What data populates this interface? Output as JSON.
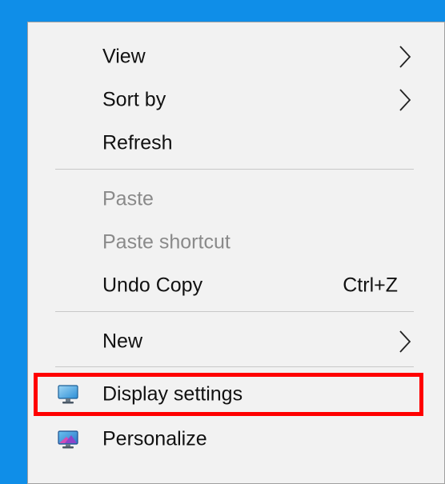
{
  "menu": {
    "items": {
      "view": {
        "label": "View",
        "icon": "chevron-right-icon"
      },
      "sort_by": {
        "label": "Sort by",
        "icon": "chevron-right-icon"
      },
      "refresh": {
        "label": "Refresh"
      },
      "paste": {
        "label": "Paste",
        "state": "disabled"
      },
      "paste_shortcut": {
        "label": "Paste shortcut",
        "state": "disabled"
      },
      "undo_copy": {
        "label": "Undo Copy",
        "shortcut": "Ctrl+Z"
      },
      "new": {
        "label": "New",
        "icon": "chevron-right-icon"
      },
      "display_settings": {
        "label": "Display settings",
        "icon": "monitor-icon"
      },
      "personalize": {
        "label": "Personalize",
        "icon": "personalize-icon"
      }
    }
  },
  "colors": {
    "desktop_background": "#0f8ee8",
    "menu_background": "#f2f2f2",
    "highlight_border": "#ff0000",
    "disabled_text": "#8a8a8a"
  }
}
